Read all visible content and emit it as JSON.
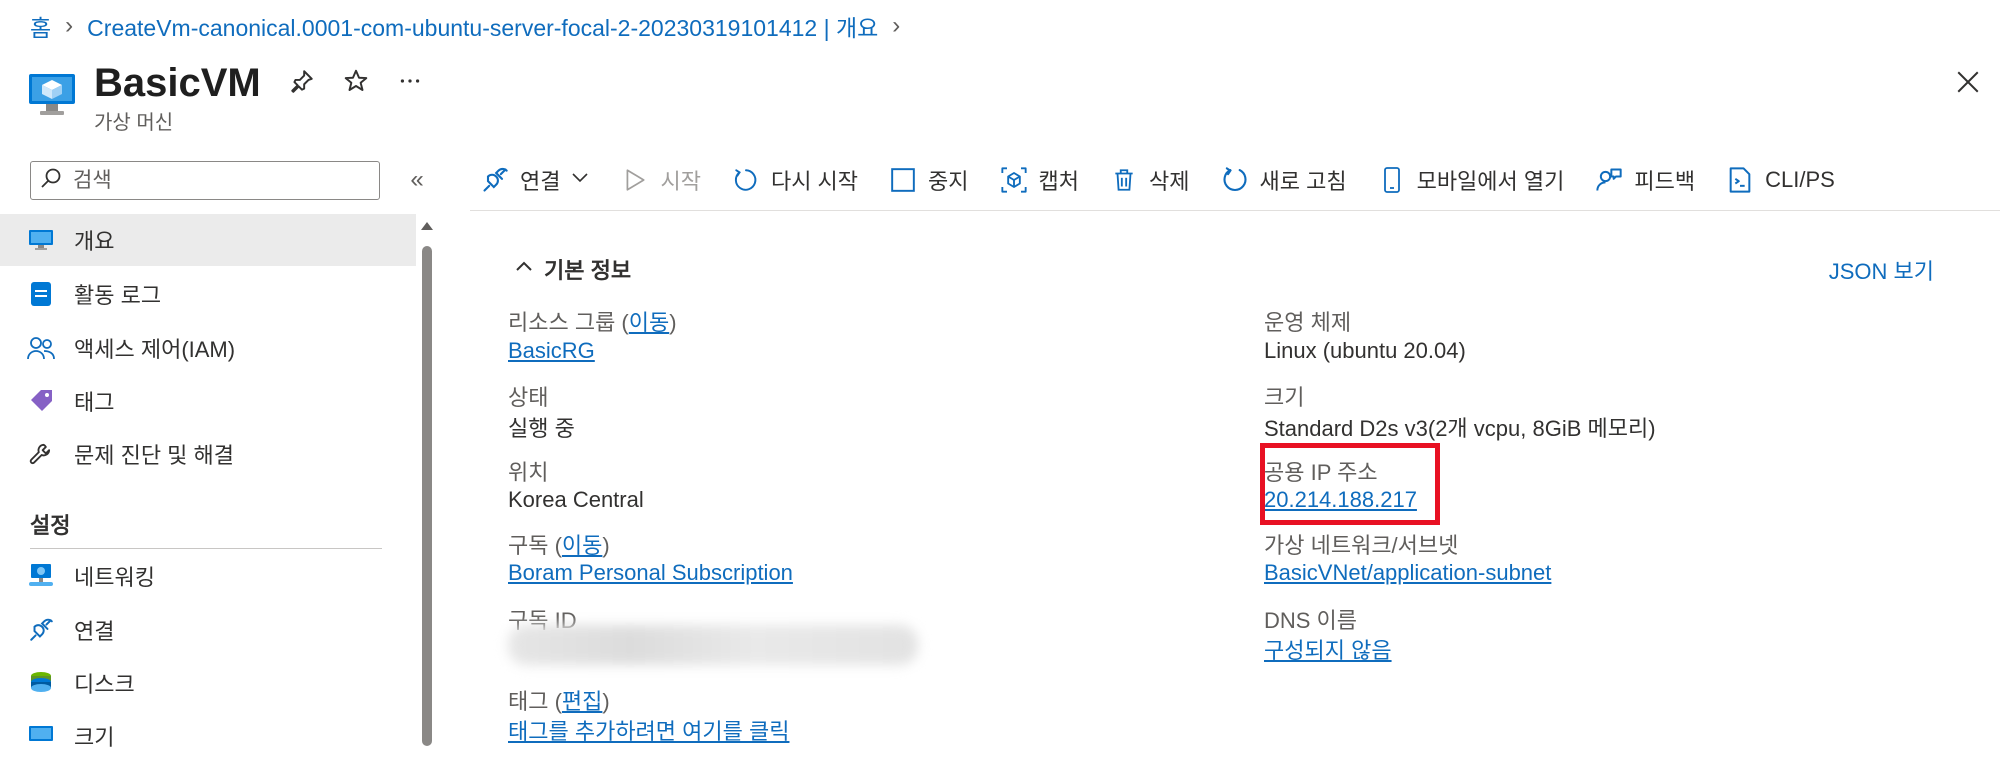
{
  "breadcrumb": {
    "home": "홈",
    "deployment": "CreateVm-canonical.0001-com-ubuntu-server-focal-2-20230319101412 | 개요"
  },
  "header": {
    "title": "BasicVM",
    "subtitle": "가상 머신"
  },
  "search": {
    "placeholder": "검색"
  },
  "sidebar": {
    "items": [
      {
        "label": "개요",
        "icon": "vm-monitor-icon"
      },
      {
        "label": "활동 로그",
        "icon": "activity-log-icon"
      },
      {
        "label": "액세스 제어(IAM)",
        "icon": "people-icon"
      },
      {
        "label": "태그",
        "icon": "tag-icon"
      },
      {
        "label": "문제 진단 및 해결",
        "icon": "wrench-icon"
      }
    ],
    "settings_header": "설정",
    "settings_items": [
      {
        "label": "네트워킹",
        "icon": "network-icon"
      },
      {
        "label": "연결",
        "icon": "connect-plug-icon"
      },
      {
        "label": "디스크",
        "icon": "disk-icon"
      },
      {
        "label": "크기",
        "icon": "size-icon"
      }
    ]
  },
  "toolbar": {
    "connect": "연결",
    "start": "시작",
    "restart": "다시 시작",
    "stop": "중지",
    "capture": "캡처",
    "delete": "삭제",
    "refresh": "새로 고침",
    "mobile": "모바일에서 열기",
    "feedback": "피드백",
    "cli": "CLI/PS"
  },
  "essentials": {
    "header": "기본 정보",
    "json_view": "JSON 보기",
    "resource_group_label": "리소스 그룹 (",
    "resource_group_move": "이동",
    "resource_group_label_end": ")",
    "resource_group_value": "BasicRG",
    "status_label": "상태",
    "status_value": "실행 중",
    "location_label": "위치",
    "location_value": "Korea Central",
    "subscription_label": "구독 (",
    "subscription_move": "이동",
    "subscription_label_end": ")",
    "subscription_value": "Boram Personal Subscription",
    "subscription_id_label": "구독 ID",
    "tags_label": "태그 (",
    "tags_edit": "편집",
    "tags_label_end": ")",
    "tags_value": "태그를 추가하려면 여기를 클릭",
    "os_label": "운영 체제",
    "os_value": "Linux (ubuntu 20.04)",
    "size_label": "크기",
    "size_value": "Standard D2s v3(2개 vcpu, 8GiB 메모리)",
    "public_ip_label": "공용 IP 주소",
    "public_ip_value": "20.214.188.217",
    "vnet_label": "가상 네트워크/서브넷",
    "vnet_value": "BasicVNet/application-subnet",
    "dns_label": "DNS 이름",
    "dns_value": "구성되지 않음"
  },
  "colors": {
    "accent_link": "#0f6cbd",
    "highlight": "#e81123",
    "active_nav_bg": "#ebebeb"
  }
}
